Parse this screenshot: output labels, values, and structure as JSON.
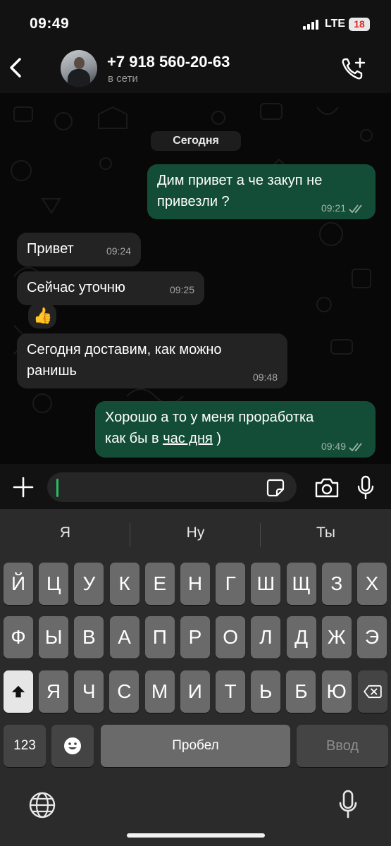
{
  "status_bar": {
    "time": "09:49",
    "network": "LTE",
    "battery": "18"
  },
  "header": {
    "contact_name": "+7 918 560-20-63",
    "contact_status": "в сети"
  },
  "chat": {
    "date_label": "Сегодня",
    "messages": [
      {
        "direction": "out",
        "text": "Дим привет а че закуп не\nпривезли ?",
        "time": "09:21",
        "read": true
      },
      {
        "direction": "in",
        "text": "Привет",
        "time": "09:24"
      },
      {
        "direction": "in",
        "text": "Сейчас уточню",
        "time": "09:25"
      },
      {
        "direction": "in",
        "text": "👍",
        "time": ""
      },
      {
        "direction": "in",
        "text": "Сегодня доставим,  как можно\nранишь",
        "time": "09:48"
      },
      {
        "direction": "out",
        "text_before": "Хорошо а то у меня проработка\nкак бы в ",
        "text_link": "час дня",
        "text_after": " )",
        "time": "09:49",
        "read": true
      }
    ]
  },
  "input": {
    "value": "",
    "placeholder": ""
  },
  "keyboard": {
    "suggestions": [
      "Я",
      "Ну",
      "Ты"
    ],
    "row1": [
      "Й",
      "Ц",
      "У",
      "К",
      "Е",
      "Н",
      "Г",
      "Ш",
      "Щ",
      "З",
      "Х"
    ],
    "row2": [
      "Ф",
      "Ы",
      "В",
      "А",
      "П",
      "Р",
      "О",
      "Л",
      "Д",
      "Ж",
      "Э"
    ],
    "row3": [
      "Я",
      "Ч",
      "С",
      "М",
      "И",
      "Т",
      "Ь",
      "Б",
      "Ю"
    ],
    "numbers_label": "123",
    "space_label": "Пробел",
    "enter_label": "Ввод"
  },
  "colors": {
    "outgoing_bubble": "#144d37",
    "incoming_bubble": "#232323",
    "cursor": "#25c060",
    "read_ticks": "#9fb7a8"
  },
  "icons": [
    "back-icon",
    "call-add-icon",
    "plus-icon",
    "sticker-icon",
    "camera-icon",
    "mic-icon",
    "shift-icon",
    "emoji-icon",
    "backspace-icon",
    "globe-icon"
  ]
}
